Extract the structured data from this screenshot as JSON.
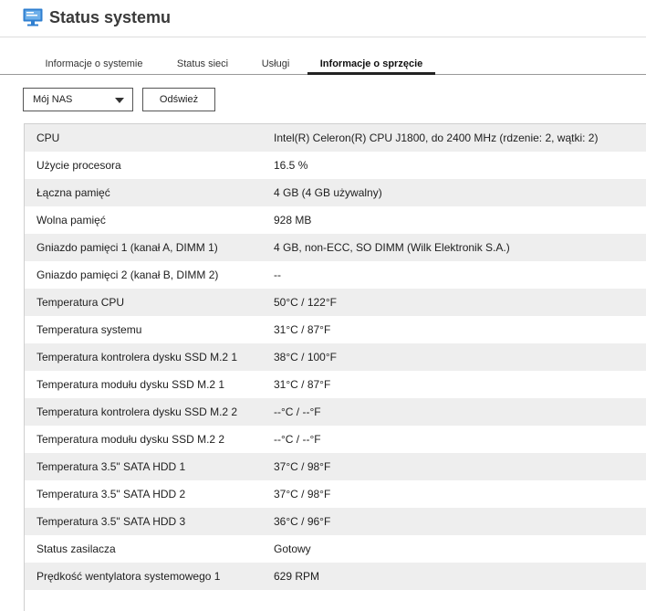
{
  "header": {
    "title": "Status systemu",
    "icon": "monitor-icon",
    "icon_color": "#2f7fd0"
  },
  "tabs": [
    {
      "label": "Informacje o systemie",
      "active": false
    },
    {
      "label": "Status sieci",
      "active": false
    },
    {
      "label": "Usługi",
      "active": false
    },
    {
      "label": "Informacje o sprzęcie",
      "active": true
    }
  ],
  "toolbar": {
    "device_select_value": "Mój NAS",
    "refresh_label": "Odśwież"
  },
  "hardware": {
    "rows": [
      {
        "label": "CPU",
        "value": "Intel(R) Celeron(R) CPU J1800, do 2400 MHz (rdzenie: 2, wątki: 2)"
      },
      {
        "label": "Użycie procesora",
        "value": "16.5 %"
      },
      {
        "label": "Łączna pamięć",
        "value": "4 GB (4 GB używalny)"
      },
      {
        "label": "Wolna pamięć",
        "value": "928 MB"
      },
      {
        "label": "Gniazdo pamięci 1 (kanał A, DIMM 1)",
        "value": "4 GB, non-ECC, SO DIMM (Wilk Elektronik S.A.)"
      },
      {
        "label": "Gniazdo pamięci 2 (kanał B, DIMM 2)",
        "value": "--"
      },
      {
        "label": "Temperatura CPU",
        "value": "50°C / 122°F"
      },
      {
        "label": "Temperatura systemu",
        "value": "31°C / 87°F"
      },
      {
        "label": "Temperatura kontrolera dysku SSD M.2 1",
        "value": "38°C / 100°F"
      },
      {
        "label": "Temperatura modułu dysku SSD M.2 1",
        "value": "31°C / 87°F"
      },
      {
        "label": "Temperatura kontrolera dysku SSD M.2 2",
        "value": "--°C / --°F"
      },
      {
        "label": "Temperatura modułu dysku SSD M.2 2",
        "value": "--°C / --°F"
      },
      {
        "label": "Temperatura 3.5\" SATA HDD 1",
        "value": "37°C / 98°F"
      },
      {
        "label": "Temperatura 3.5\" SATA HDD 2",
        "value": "37°C / 98°F"
      },
      {
        "label": "Temperatura 3.5\" SATA HDD 3",
        "value": "36°C / 96°F"
      },
      {
        "label": "Status zasilacza",
        "value": "Gotowy"
      },
      {
        "label": "Prędkość wentylatora systemowego 1",
        "value": "629 RPM"
      }
    ]
  }
}
